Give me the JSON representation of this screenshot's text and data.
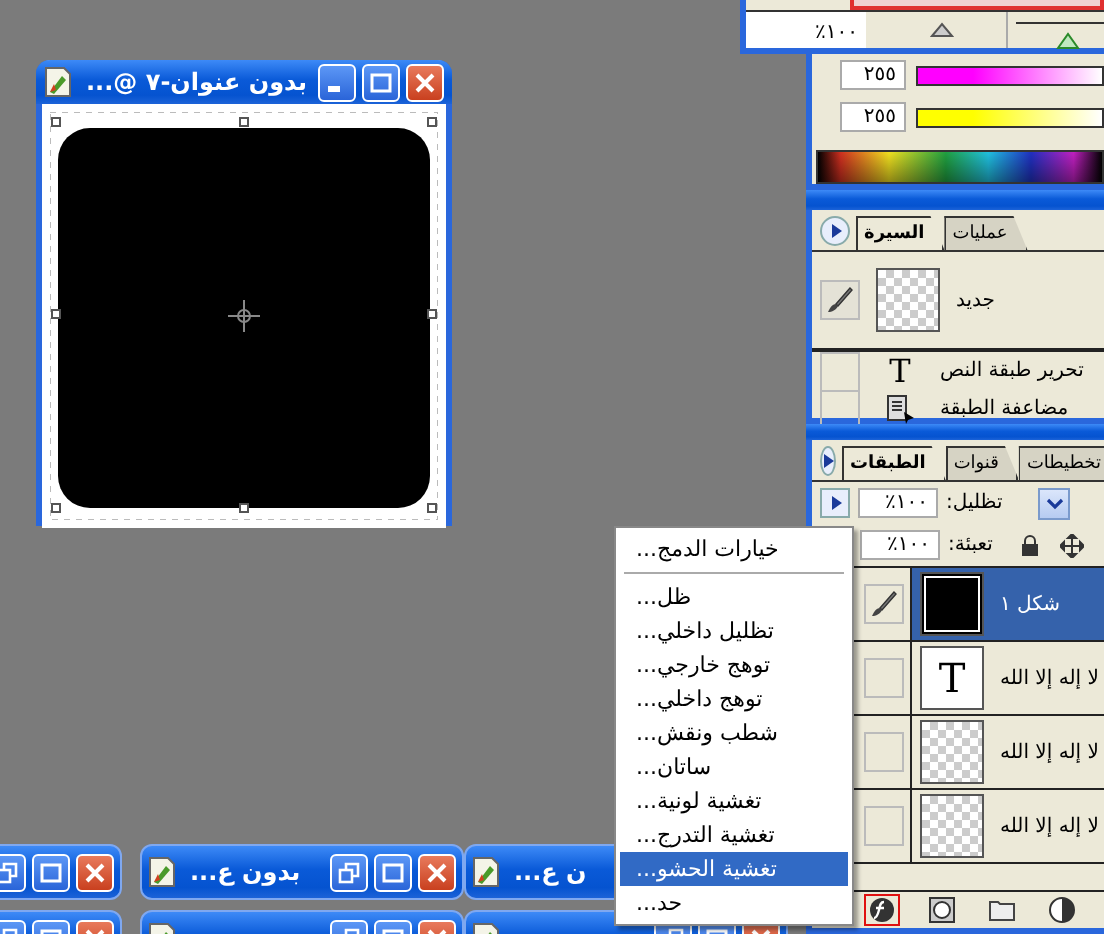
{
  "document_window": {
    "title": "بدون عنوان-٧ @..."
  },
  "swatch_strip": {
    "field": "١٠٠٪",
    "slider": {
      "level": 0.62
    }
  },
  "color_panel": {
    "channels": [
      {
        "value": "٢٥٥",
        "color": "#ff00ff"
      },
      {
        "value": "٢٥٥",
        "color": "#ffff00"
      }
    ]
  },
  "history_panel": {
    "tabs": [
      {
        "label": "عمليات",
        "selected": false
      },
      {
        "label": "السيرة",
        "selected": true
      }
    ],
    "snapshot": {
      "label": "جديد"
    },
    "items": [
      {
        "label": "تحرير طبقة النص",
        "kind": "text",
        "glyph": "T"
      },
      {
        "label": "مضاعفة الطبقة",
        "kind": "duplicate"
      }
    ]
  },
  "layers_panel": {
    "tabs": [
      {
        "label": "تخطيطات",
        "selected": false
      },
      {
        "label": "قنوات",
        "selected": false
      },
      {
        "label": "الطبقات",
        "selected": true
      }
    ],
    "opacity_label": "تظليل:",
    "opacity": "١٠٠٪",
    "fill_label": "تعبئة:",
    "fill": "١٠٠٪",
    "layers": [
      {
        "name": "شكل ١",
        "kind": "shape",
        "selected": true
      },
      {
        "name": "لا إله إلا الله",
        "kind": "text",
        "glyph": "T",
        "selected": false
      },
      {
        "name": "لا إله إلا الله",
        "kind": "raster",
        "selected": false
      },
      {
        "name": "لا إله إلا الله",
        "kind": "raster",
        "selected": false
      }
    ]
  },
  "context_menu": {
    "groups": [
      [
        {
          "label": "خيارات الدمج...",
          "selected": false
        }
      ],
      [
        {
          "label": "ظل...",
          "selected": false
        },
        {
          "label": "تظليل داخلي...",
          "selected": false
        },
        {
          "label": "توهج خارجي...",
          "selected": false
        },
        {
          "label": "توهج داخلي...",
          "selected": false
        },
        {
          "label": "شطب ونقش...",
          "selected": false
        },
        {
          "label": "ساتان...",
          "selected": false
        },
        {
          "label": "تغشية لونية...",
          "selected": false
        },
        {
          "label": "تغشية التدرج...",
          "selected": false
        },
        {
          "label": "تغشية الحشو...",
          "selected": true
        },
        {
          "label": "حد...",
          "selected": false
        }
      ]
    ]
  },
  "minimized_windows": [
    {
      "kind": "window",
      "title": "ن ع..."
    },
    {
      "kind": "window",
      "title": "بدون ع..."
    },
    {
      "kind": "window"
    },
    {
      "kind": "window"
    },
    {
      "kind": "window"
    },
    {
      "kind": "window"
    }
  ]
}
